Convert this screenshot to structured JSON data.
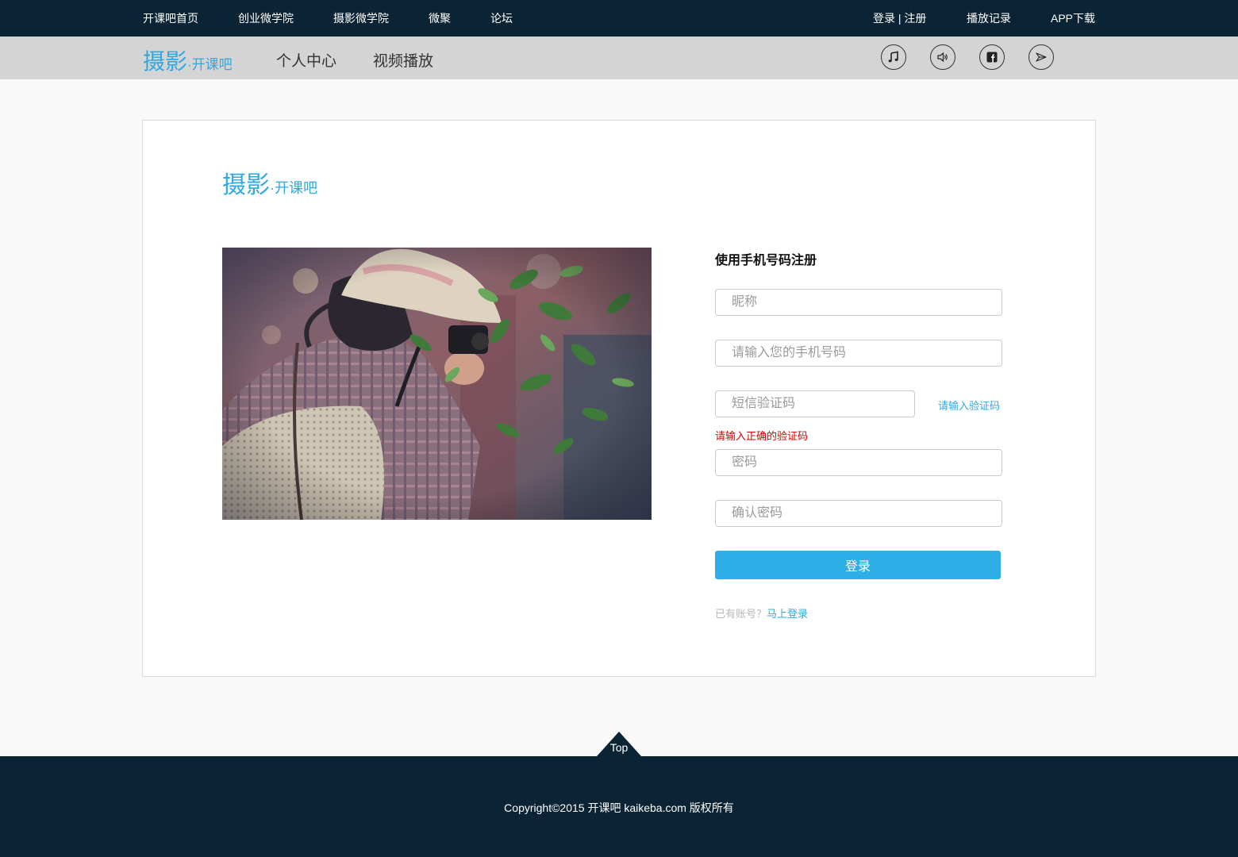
{
  "topbar": {
    "left_links": [
      "开课吧首页",
      "创业微学院",
      "摄影微学院",
      "微聚",
      "论坛"
    ],
    "login_register": "登录 | 注册",
    "play_history": "播放记录",
    "app_download": "APP下载"
  },
  "subnav": {
    "brand_big": "摄影",
    "brand_small": "·开课吧",
    "items": [
      "个人中心",
      "视频播放"
    ],
    "icons": [
      "music-icon",
      "speaker-icon",
      "facebook-icon",
      "send-icon"
    ]
  },
  "card": {
    "brand_big": "摄影",
    "brand_small": "·开课吧",
    "photo_alt": "photographer-with-camera",
    "form": {
      "title": "使用手机号码注册",
      "nickname_placeholder": "昵称",
      "phone_placeholder": "请输入您的手机号码",
      "sms_placeholder": "短信验证码",
      "get_code_link": "请输入验证码",
      "error_text": "请输入正确的验证码",
      "password_placeholder": "密码",
      "confirm_placeholder": "确认密码",
      "submit_label": "登录",
      "have_account": "已有账号？",
      "login_now": "马上登录"
    }
  },
  "footer": {
    "top_label": "Top",
    "copyright": "Copyright©2015 开课吧 kaikeba.com 版权所有"
  },
  "colors": {
    "dark_navy": "#0b2435",
    "subnav_gray": "#d4d4d4",
    "accent_blue": "#2ea9e0",
    "button_blue": "#2eaee6",
    "error_red": "#d40000"
  }
}
